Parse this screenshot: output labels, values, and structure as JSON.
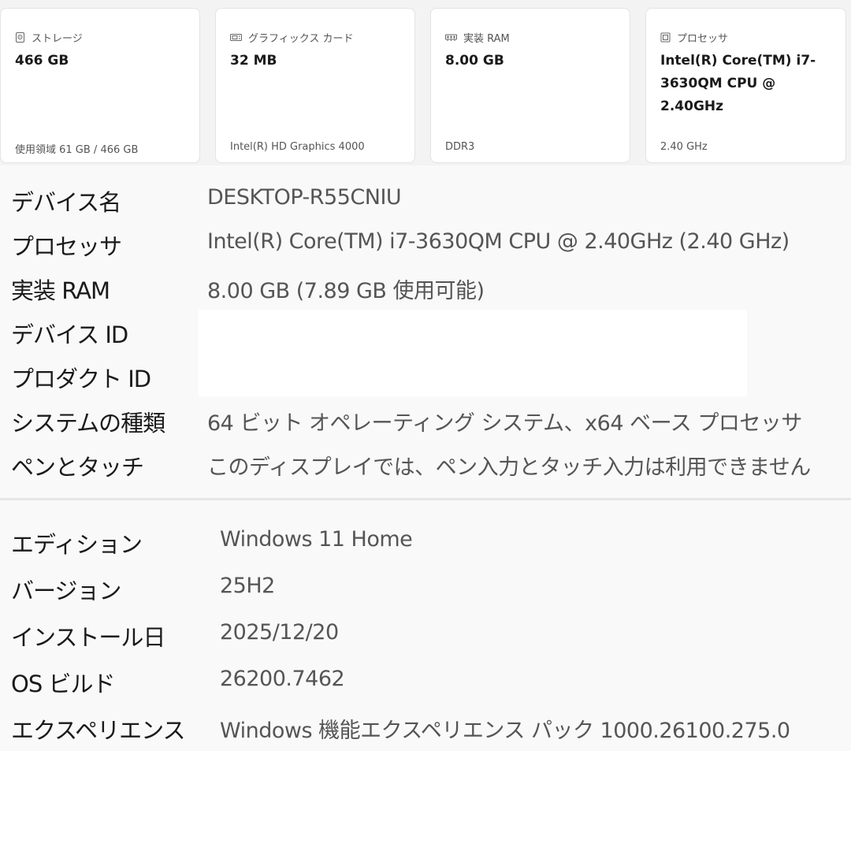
{
  "cards": [
    {
      "icon": "storage-icon",
      "label": "ストレージ",
      "value": "466 GB",
      "sub": "使用領域 61 GB / 466 GB"
    },
    {
      "icon": "graphics-card-icon",
      "label": "グラフィックス カード",
      "value": "32 MB",
      "sub": "Intel(R) HD Graphics 4000"
    },
    {
      "icon": "ram-icon",
      "label": "実装 RAM",
      "value": "8.00 GB",
      "sub": "DDR3"
    },
    {
      "icon": "processor-icon",
      "label": "プロセッサ",
      "value": "Intel(R) Core(TM) i7-3630QM CPU @ 2.40GHz",
      "sub": "2.40 GHz"
    }
  ],
  "device_specs": [
    {
      "label": "デバイス名",
      "value": "DESKTOP-R55CNIU"
    },
    {
      "label": "プロセッサ",
      "value": "Intel(R) Core(TM) i7-3630QM CPU @ 2.40GHz (2.40 GHz)"
    },
    {
      "label": "実装 RAM",
      "value": "8.00 GB (7.89 GB 使用可能)"
    },
    {
      "label": "デバイス ID",
      "value": ""
    },
    {
      "label": "プロダクト ID",
      "value": ""
    },
    {
      "label": "システムの種類",
      "value": "64 ビット オペレーティング システム、x64 ベース プロセッサ"
    },
    {
      "label": "ペンとタッチ",
      "value": "このディスプレイでは、ペン入力とタッチ入力は利用できません"
    }
  ],
  "windows_specs": [
    {
      "label": "エディション",
      "value": "Windows 11 Home"
    },
    {
      "label": "バージョン",
      "value": "25H2"
    },
    {
      "label": "インストール日",
      "value": "2025/12/20"
    },
    {
      "label": "OS ビルド",
      "value": "26200.7462"
    },
    {
      "label": "エクスペリエンス",
      "value": "Windows 機能エクスペリエンス パック 1000.26100.275.0"
    }
  ]
}
